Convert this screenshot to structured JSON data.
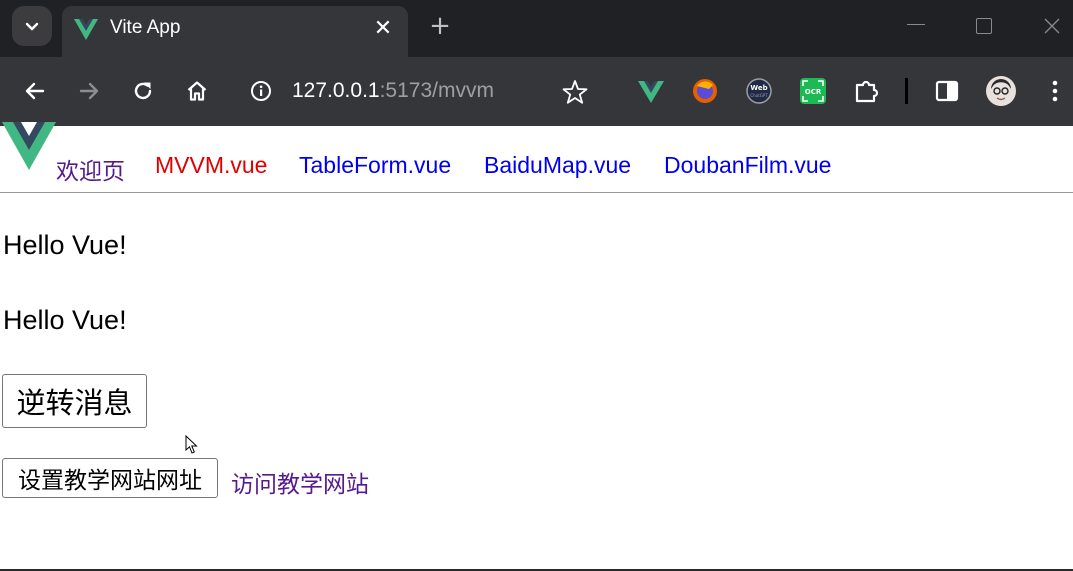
{
  "browser": {
    "tab_title": "Vite App",
    "tab_close_glyph": "✕",
    "new_tab_glyph": "+",
    "url_host": "127.0.0.1",
    "url_rest": ":5173/mvvm",
    "colors": {
      "vue_green": "#41b883",
      "vue_dark": "#35495e",
      "tab_active": "#35363a",
      "tabbar": "#202124"
    }
  },
  "nav": {
    "links": [
      {
        "label": "欢迎页",
        "color": "#551a8b"
      },
      {
        "label": "MVVM.vue",
        "color": "#e00000"
      },
      {
        "label": "TableForm.vue",
        "color": "#0000ee"
      },
      {
        "label": "BaiduMap.vue",
        "color": "#0000ee"
      },
      {
        "label": "DoubanFilm.vue",
        "color": "#0000ee"
      }
    ]
  },
  "content": {
    "message_1": "Hello Vue!",
    "message_2": "Hello Vue!",
    "reverse_button": "逆转消息",
    "set_url_button": "设置教学网站网址",
    "visit_link": "访问教学网站"
  }
}
